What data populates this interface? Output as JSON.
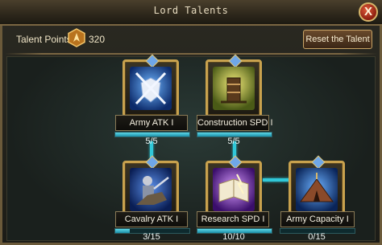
{
  "window": {
    "title": "Lord Talents",
    "close_label": "X"
  },
  "header": {
    "talent_points_label": "Talent Points:",
    "talent_points_value": "320",
    "reset_label": "Reset the Talent"
  },
  "talents": [
    {
      "name": "Army ATK I",
      "progress": "5/5",
      "fraction": 1.0,
      "icon": "crossed-swords-shield-icon"
    },
    {
      "name": "Construction SPD I",
      "progress": "5/5",
      "fraction": 1.0,
      "icon": "construction-tower-icon"
    },
    {
      "name": "Cavalry ATK I",
      "progress": "3/15",
      "fraction": 0.2,
      "icon": "cavalry-knight-icon"
    },
    {
      "name": "Research SPD I",
      "progress": "10/10",
      "fraction": 1.0,
      "icon": "research-book-icon"
    },
    {
      "name": "Army Capacity I",
      "progress": "0/15",
      "fraction": 0.0,
      "icon": "army-tent-icon"
    }
  ],
  "colors": {
    "frame": "#c9a24e",
    "connector": "#30c8d8",
    "progress": "#5cd6e6"
  }
}
